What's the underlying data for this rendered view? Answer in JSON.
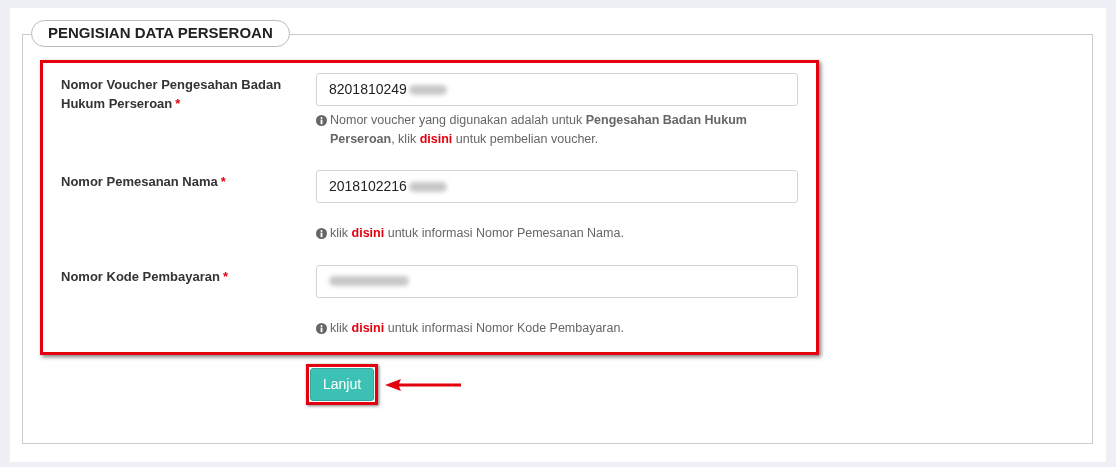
{
  "section": {
    "title": "PENGISIAN DATA PERSEROAN"
  },
  "fields": [
    {
      "label": "Nomor Voucher Pengesahan Badan Hukum Perseroan",
      "required_mark": "*",
      "value": "8201810249",
      "blurred": true,
      "help_before": "Nomor voucher yang digunakan adalah untuk **Pengesahan Badan Hukum Perseroan**, klik",
      "help_link": "disini",
      "help_after": "untuk pembelian voucher."
    },
    {
      "label": "Nomor Pemesanan Nama",
      "required_mark": "*",
      "value": "2018102216",
      "blurred": true,
      "help_before": "klik",
      "help_link": "disini",
      "help_after": "untuk informasi Nomor Pemesanan Nama."
    },
    {
      "label": "Nomor Kode Pembayaran",
      "required_mark": "*",
      "blurred": true,
      "help_before": "klik",
      "help_link": "disini",
      "help_after": "untuk informasi Nomor Kode Pembayaran."
    }
  ],
  "button": {
    "label": "Lanjut"
  }
}
